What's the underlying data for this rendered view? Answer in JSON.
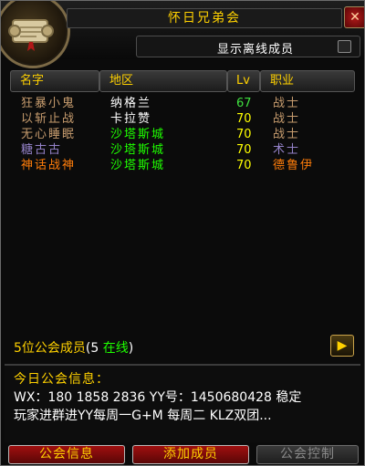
{
  "window": {
    "title": "怀日兄弟会",
    "close_label": "✕"
  },
  "toggle": {
    "label": "显示离线成员",
    "checked": false
  },
  "columns": {
    "name": "名字",
    "zone": "地区",
    "level": "Lv",
    "class": "职业"
  },
  "colors": {
    "gold": "#ffd100",
    "white": "#ffffff",
    "green": "#1eff00",
    "level_green": "#3fe03f",
    "level_yellow": "#ffff00",
    "warrior": "#c79c6e",
    "warlock": "#9482c9",
    "druid": "#ff7d0a",
    "zone_green": "#1eff00"
  },
  "members": [
    {
      "name": "狂暴小鬼",
      "zone": "纳格兰",
      "level": "67",
      "class": "战士",
      "name_color": "#c79c6e",
      "zone_color": "#ffffff",
      "level_color": "#3fe03f",
      "class_color": "#c79c6e"
    },
    {
      "name": "以斩止战",
      "zone": "卡拉赞",
      "level": "70",
      "class": "战士",
      "name_color": "#c79c6e",
      "zone_color": "#ffffff",
      "level_color": "#ffff00",
      "class_color": "#c79c6e"
    },
    {
      "name": "无心睡眠",
      "zone": "沙塔斯城",
      "level": "70",
      "class": "战士",
      "name_color": "#c79c6e",
      "zone_color": "#1eff00",
      "level_color": "#ffff00",
      "class_color": "#c79c6e"
    },
    {
      "name": "糖古古",
      "zone": "沙塔斯城",
      "level": "70",
      "class": "术士",
      "name_color": "#9482c9",
      "zone_color": "#1eff00",
      "level_color": "#ffff00",
      "class_color": "#9482c9"
    },
    {
      "name": "神话战神",
      "zone": "沙塔斯城",
      "level": "70",
      "class": "德鲁伊",
      "name_color": "#ff7d0a",
      "zone_color": "#1eff00",
      "level_color": "#ffff00",
      "class_color": "#ff7d0a"
    }
  ],
  "summary": {
    "count_prefix": "5位公会成员",
    "online_open": "(5 ",
    "online_word": "在线",
    "online_close": ")"
  },
  "motd": {
    "title": "今日公会信息：",
    "line1": "WX：180 1858 2836 YY号：1450680428 稳定",
    "line2": "玩家进群进YY每周一G+M  每周二 KLZ双团..."
  },
  "buttons": {
    "guild_info": "公会信息",
    "add_member": "添加成员",
    "guild_control": "公会控制"
  },
  "icons": {
    "portrait": "guild-scroll-icon",
    "next": "next-page-arrow-icon"
  }
}
